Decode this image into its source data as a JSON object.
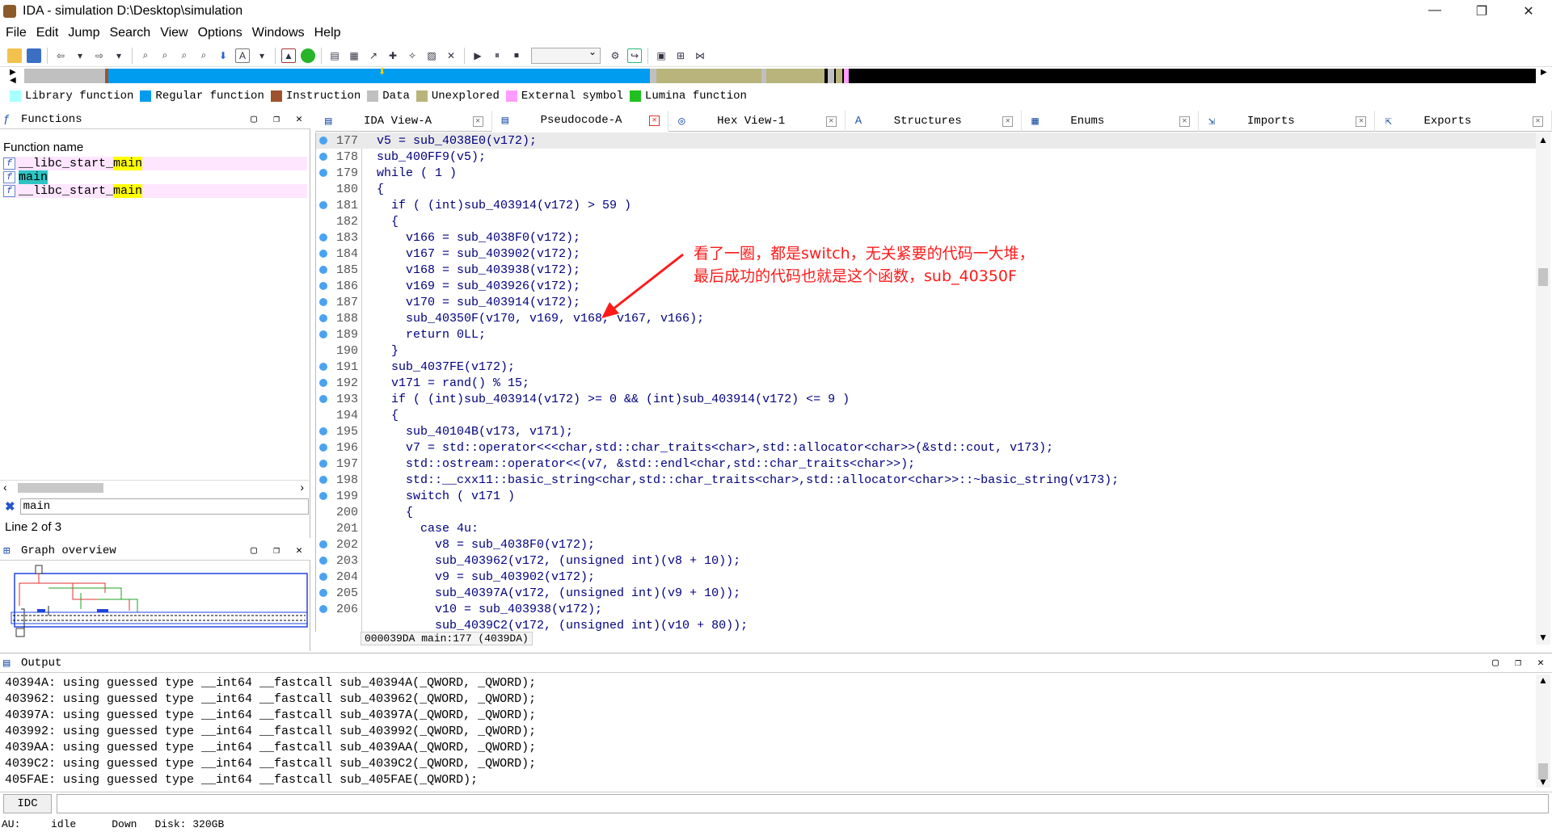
{
  "window": {
    "title": "IDA - simulation D:\\Desktop\\simulation",
    "min": "—",
    "max": "❐",
    "close": "✕"
  },
  "menu": [
    "File",
    "Edit",
    "Jump",
    "Search",
    "View",
    "Options",
    "Windows",
    "Help"
  ],
  "legend": [
    {
      "label": "Library function",
      "color": "#a8ffff"
    },
    {
      "label": "Regular function",
      "color": "#009cf0"
    },
    {
      "label": "Instruction",
      "color": "#a0522d"
    },
    {
      "label": "Data",
      "color": "#c0c0c0"
    },
    {
      "label": "Unexplored",
      "color": "#b8b47c"
    },
    {
      "label": "External symbol",
      "color": "#ff9cff"
    },
    {
      "label": "Lumina function",
      "color": "#20c020"
    }
  ],
  "functions": {
    "title": "Functions",
    "column": "Function name",
    "rows": [
      {
        "name_pre": "__libc_start_",
        "name_hl": "main",
        "kind": "lib"
      },
      {
        "name_pre": "",
        "name_hl": "main",
        "kind": "sel"
      },
      {
        "name_pre": "__libc_start_",
        "name_hl": "main",
        "kind": "lib"
      }
    ],
    "filter": "main",
    "status": "Line 2 of 3"
  },
  "graph_overview": {
    "title": "Graph overview"
  },
  "tabs": [
    {
      "label": "IDA View-A",
      "icon": "ida-view-icon"
    },
    {
      "label": "Pseudocode-A",
      "icon": "pseudocode-icon",
      "active": true
    },
    {
      "label": "Hex View-1",
      "icon": "hex-view-icon"
    },
    {
      "label": "Structures",
      "icon": "structures-icon"
    },
    {
      "label": "Enums",
      "icon": "enums-icon"
    },
    {
      "label": "Imports",
      "icon": "imports-icon"
    },
    {
      "label": "Exports",
      "icon": "exports-icon"
    }
  ],
  "code": [
    {
      "n": "177",
      "dot": true,
      "t": "v5 = sub_4038E0(v172);",
      "cur": true
    },
    {
      "n": "178",
      "dot": true,
      "t": "sub_400FF9(v5);"
    },
    {
      "n": "179",
      "dot": true,
      "t": "while ( 1 )"
    },
    {
      "n": "180",
      "dot": false,
      "t": "{"
    },
    {
      "n": "181",
      "dot": true,
      "t": "  if ( (int)sub_403914(v172) > 59 )"
    },
    {
      "n": "182",
      "dot": false,
      "t": "  {"
    },
    {
      "n": "183",
      "dot": true,
      "t": "    v166 = sub_4038F0(v172);"
    },
    {
      "n": "184",
      "dot": true,
      "t": "    v167 = sub_403902(v172);"
    },
    {
      "n": "185",
      "dot": true,
      "t": "    v168 = sub_403938(v172);"
    },
    {
      "n": "186",
      "dot": true,
      "t": "    v169 = sub_403926(v172);"
    },
    {
      "n": "187",
      "dot": true,
      "t": "    v170 = sub_403914(v172);"
    },
    {
      "n": "188",
      "dot": true,
      "t": "    sub_40350F(v170, v169, v168, v167, v166);"
    },
    {
      "n": "189",
      "dot": true,
      "t": "    return 0LL;"
    },
    {
      "n": "190",
      "dot": false,
      "t": "  }"
    },
    {
      "n": "191",
      "dot": true,
      "t": "  sub_4037FE(v172);"
    },
    {
      "n": "192",
      "dot": true,
      "t": "  v171 = rand() % 15;"
    },
    {
      "n": "193",
      "dot": true,
      "t": "  if ( (int)sub_403914(v172) >= 0 && (int)sub_403914(v172) <= 9 )"
    },
    {
      "n": "194",
      "dot": false,
      "t": "  {"
    },
    {
      "n": "195",
      "dot": true,
      "t": "    sub_40104B(v173, v171);"
    },
    {
      "n": "196",
      "dot": true,
      "t": "    v7 = std::operator<<<char,std::char_traits<char>,std::allocator<char>>(&std::cout, v173);"
    },
    {
      "n": "197",
      "dot": true,
      "t": "    std::ostream::operator<<(v7, &std::endl<char,std::char_traits<char>>);"
    },
    {
      "n": "198",
      "dot": true,
      "t": "    std::__cxx11::basic_string<char,std::char_traits<char>,std::allocator<char>>::~basic_string(v173);"
    },
    {
      "n": "199",
      "dot": true,
      "t": "    switch ( v171 )"
    },
    {
      "n": "200",
      "dot": false,
      "t": "    {"
    },
    {
      "n": "201",
      "dot": false,
      "t": "      case 4u:"
    },
    {
      "n": "202",
      "dot": true,
      "t": "        v8 = sub_4038F0(v172);"
    },
    {
      "n": "203",
      "dot": true,
      "t": "        sub_403962(v172, (unsigned int)(v8 + 10));"
    },
    {
      "n": "204",
      "dot": true,
      "t": "        v9 = sub_403902(v172);"
    },
    {
      "n": "205",
      "dot": true,
      "t": "        sub_40397A(v172, (unsigned int)(v9 + 10));"
    },
    {
      "n": "206",
      "dot": true,
      "t": "        v10 = sub_403938(v172);"
    },
    {
      "n": "",
      "dot": false,
      "t": "        sub_4039C2(v172, (unsigned int)(v10 + 80));"
    }
  ],
  "code_status": "000039DA main:177 (4039DA)",
  "annotation": {
    "line1": "看了一圈，都是switch，无关紧要的代码一大堆，",
    "line2": "最后成功的代码也就是这个函数，sub_40350F",
    "color": "#ff1a1a"
  },
  "output": {
    "title": "Output",
    "lines": [
      "40394A: using guessed type __int64 __fastcall sub_40394A(_QWORD, _QWORD);",
      "403962: using guessed type __int64 __fastcall sub_403962(_QWORD, _QWORD);",
      "40397A: using guessed type __int64 __fastcall sub_40397A(_QWORD, _QWORD);",
      "403992: using guessed type __int64 __fastcall sub_403992(_QWORD, _QWORD);",
      "4039AA: using guessed type __int64 __fastcall sub_4039AA(_QWORD, _QWORD);",
      "4039C2: using guessed type __int64 __fastcall sub_4039C2(_QWORD, _QWORD);",
      "405FAE: using guessed type __int64 __fastcall sub_405FAE(_QWORD);"
    ]
  },
  "idc": {
    "button": "IDC",
    "value": ""
  },
  "status": {
    "au": "AU:",
    "state": "idle",
    "dir": "Down",
    "disk": "Disk: 320GB"
  }
}
